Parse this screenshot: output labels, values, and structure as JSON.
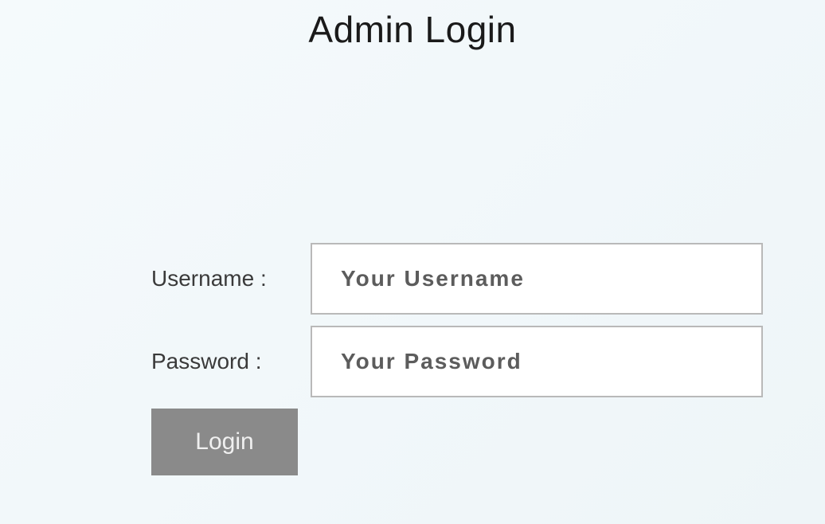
{
  "page": {
    "title": "Admin Login"
  },
  "form": {
    "username": {
      "label": "Username :",
      "placeholder": "Your Username",
      "value": ""
    },
    "password": {
      "label": "Password :",
      "placeholder": "Your Password",
      "value": ""
    },
    "submit_label": "Login"
  },
  "colors": {
    "background_start": "#f5fafc",
    "background_end": "#eef5f8",
    "input_border": "#b9b9b9",
    "input_bg": "#ffffff",
    "button_bg": "#8a8a8a",
    "button_text": "#f0f0f0",
    "text_primary": "#1a1a1a",
    "text_label": "#3a3a3a"
  }
}
